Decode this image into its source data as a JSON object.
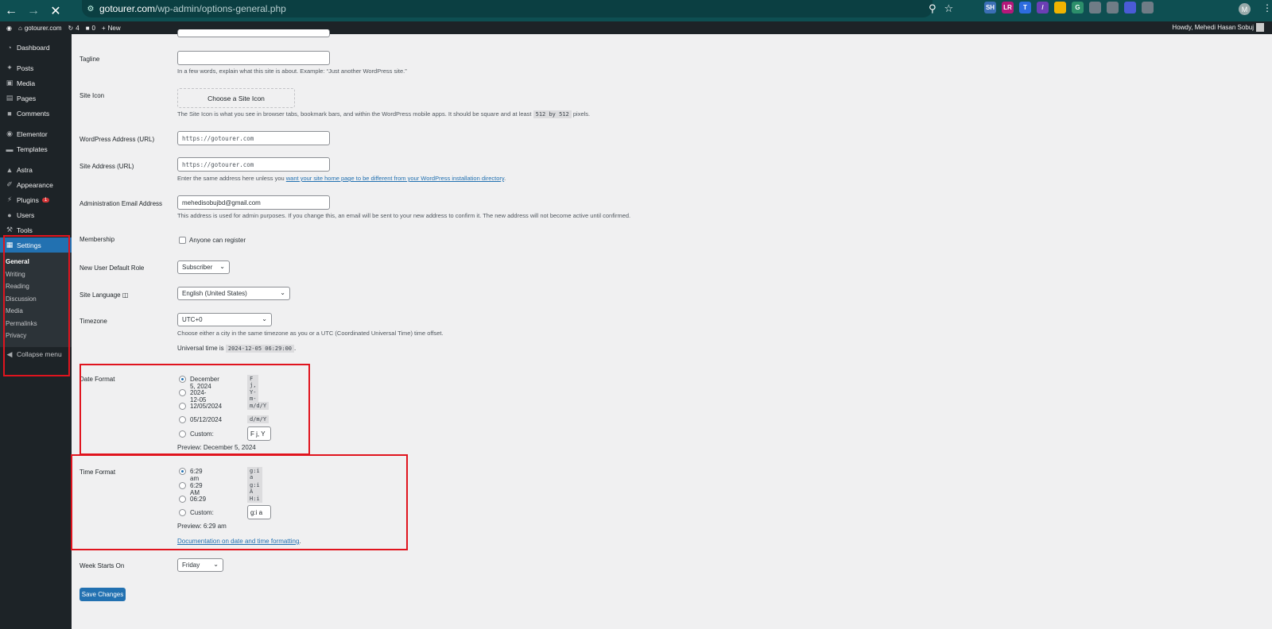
{
  "browser": {
    "url_host": "gotourer.com",
    "url_path": "/wp-admin/options-general.php",
    "extensions": [
      {
        "name": "SH",
        "color": "#3b6fb6"
      },
      {
        "name": "LR",
        "color": "#b4177a"
      },
      {
        "name": "T",
        "color": "#2d6cdf"
      },
      {
        "name": "/",
        "color": "#6b3fb5"
      },
      {
        "name": "",
        "color": "#f0b400"
      },
      {
        "name": "G",
        "color": "#2c8f6b"
      },
      {
        "name": "",
        "color": "#6f7c86"
      },
      {
        "name": "",
        "color": "#6f7c86"
      },
      {
        "name": "",
        "color": "#4a5bd6"
      },
      {
        "name": "",
        "color": "#6f7c86"
      }
    ],
    "profile_initial": "M"
  },
  "admin_bar": {
    "site_name": "gotourer.com",
    "updates_count": "4",
    "comments_count": "0",
    "new_label": "New",
    "howdy": "Howdy, Mehedi Hasan Sobuj"
  },
  "sidebar": {
    "dashboard": "Dashboard",
    "posts": "Posts",
    "media": "Media",
    "pages": "Pages",
    "comments": "Comments",
    "elementor": "Elementor",
    "templates": "Templates",
    "astra": "Astra",
    "appearance": "Appearance",
    "plugins": "Plugins",
    "plugins_badge": "1",
    "users": "Users",
    "tools": "Tools",
    "settings": "Settings",
    "submenu": {
      "general": "General",
      "writing": "Writing",
      "reading": "Reading",
      "discussion": "Discussion",
      "media": "Media",
      "permalinks": "Permalinks",
      "privacy": "Privacy"
    },
    "collapse": "Collapse menu"
  },
  "form": {
    "tagline_label": "Tagline",
    "tagline_value": "",
    "tagline_desc": "In a few words, explain what this site is about. Example: “Just another WordPress site.”",
    "site_icon_label": "Site Icon",
    "site_icon_button": "Choose a Site Icon",
    "site_icon_desc_1": "The Site Icon is what you see in browser tabs, bookmark bars, and within the WordPress mobile apps. It should be square and at least",
    "site_icon_code": "512 by 512",
    "site_icon_desc_2": "pixels.",
    "wp_address_label": "WordPress Address (URL)",
    "wp_address_value": "https://gotourer.com",
    "site_address_label": "Site Address (URL)",
    "site_address_value": "https://gotourer.com",
    "site_address_desc_1": "Enter the same address here unless you",
    "site_address_link": "want your site home page to be different from your WordPress installation directory",
    "site_address_desc_2": ".",
    "admin_email_label": "Administration Email Address",
    "admin_email_value": "mehedisobujbd@gmail.com",
    "admin_email_desc": "This address is used for admin purposes. If you change this, an email will be sent to your new address to confirm it. The new address will not become active until confirmed.",
    "membership_label": "Membership",
    "membership_checkbox": "Anyone can register",
    "default_role_label": "New User Default Role",
    "default_role_value": "Subscriber",
    "language_label": "Site Language",
    "language_value": "English (United States)",
    "timezone_label": "Timezone",
    "timezone_value": "UTC+0",
    "timezone_desc": "Choose either a city in the same timezone as you or a UTC (Coordinated Universal Time) time offset.",
    "universal_time_label": "Universal time is",
    "universal_time_value": "2024-12-05 06:29:00",
    "universal_time_end": ".",
    "date_format_label": "Date Format",
    "date_options": [
      {
        "label": "December 5, 2024",
        "code": "F j, Y",
        "checked": true
      },
      {
        "label": "2024-12-05",
        "code": "Y-m-d",
        "checked": false
      },
      {
        "label": "12/05/2024",
        "code": "m/d/Y",
        "checked": false
      },
      {
        "label": "05/12/2024",
        "code": "d/m/Y",
        "checked": false
      }
    ],
    "date_custom_label": "Custom:",
    "date_custom_value": "F j, Y",
    "date_preview": "Preview: December 5, 2024",
    "time_format_label": "Time Format",
    "time_options": [
      {
        "label": "6:29 am",
        "code": "g:i a",
        "checked": true
      },
      {
        "label": "6:29 AM",
        "code": "g:i A",
        "checked": false
      },
      {
        "label": "06:29",
        "code": "H:i",
        "checked": false
      }
    ],
    "time_custom_label": "Custom:",
    "time_custom_value": "g:i a",
    "time_preview": "Preview: 6:29 am",
    "doc_link": "Documentation on date and time formatting",
    "doc_link_end": ".",
    "week_starts_label": "Week Starts On",
    "week_starts_value": "Friday",
    "save_button": "Save Changes"
  },
  "colors": {
    "highlight": "#e0141e",
    "wp_blue": "#2271b1",
    "admin_dark": "#1d2327"
  }
}
